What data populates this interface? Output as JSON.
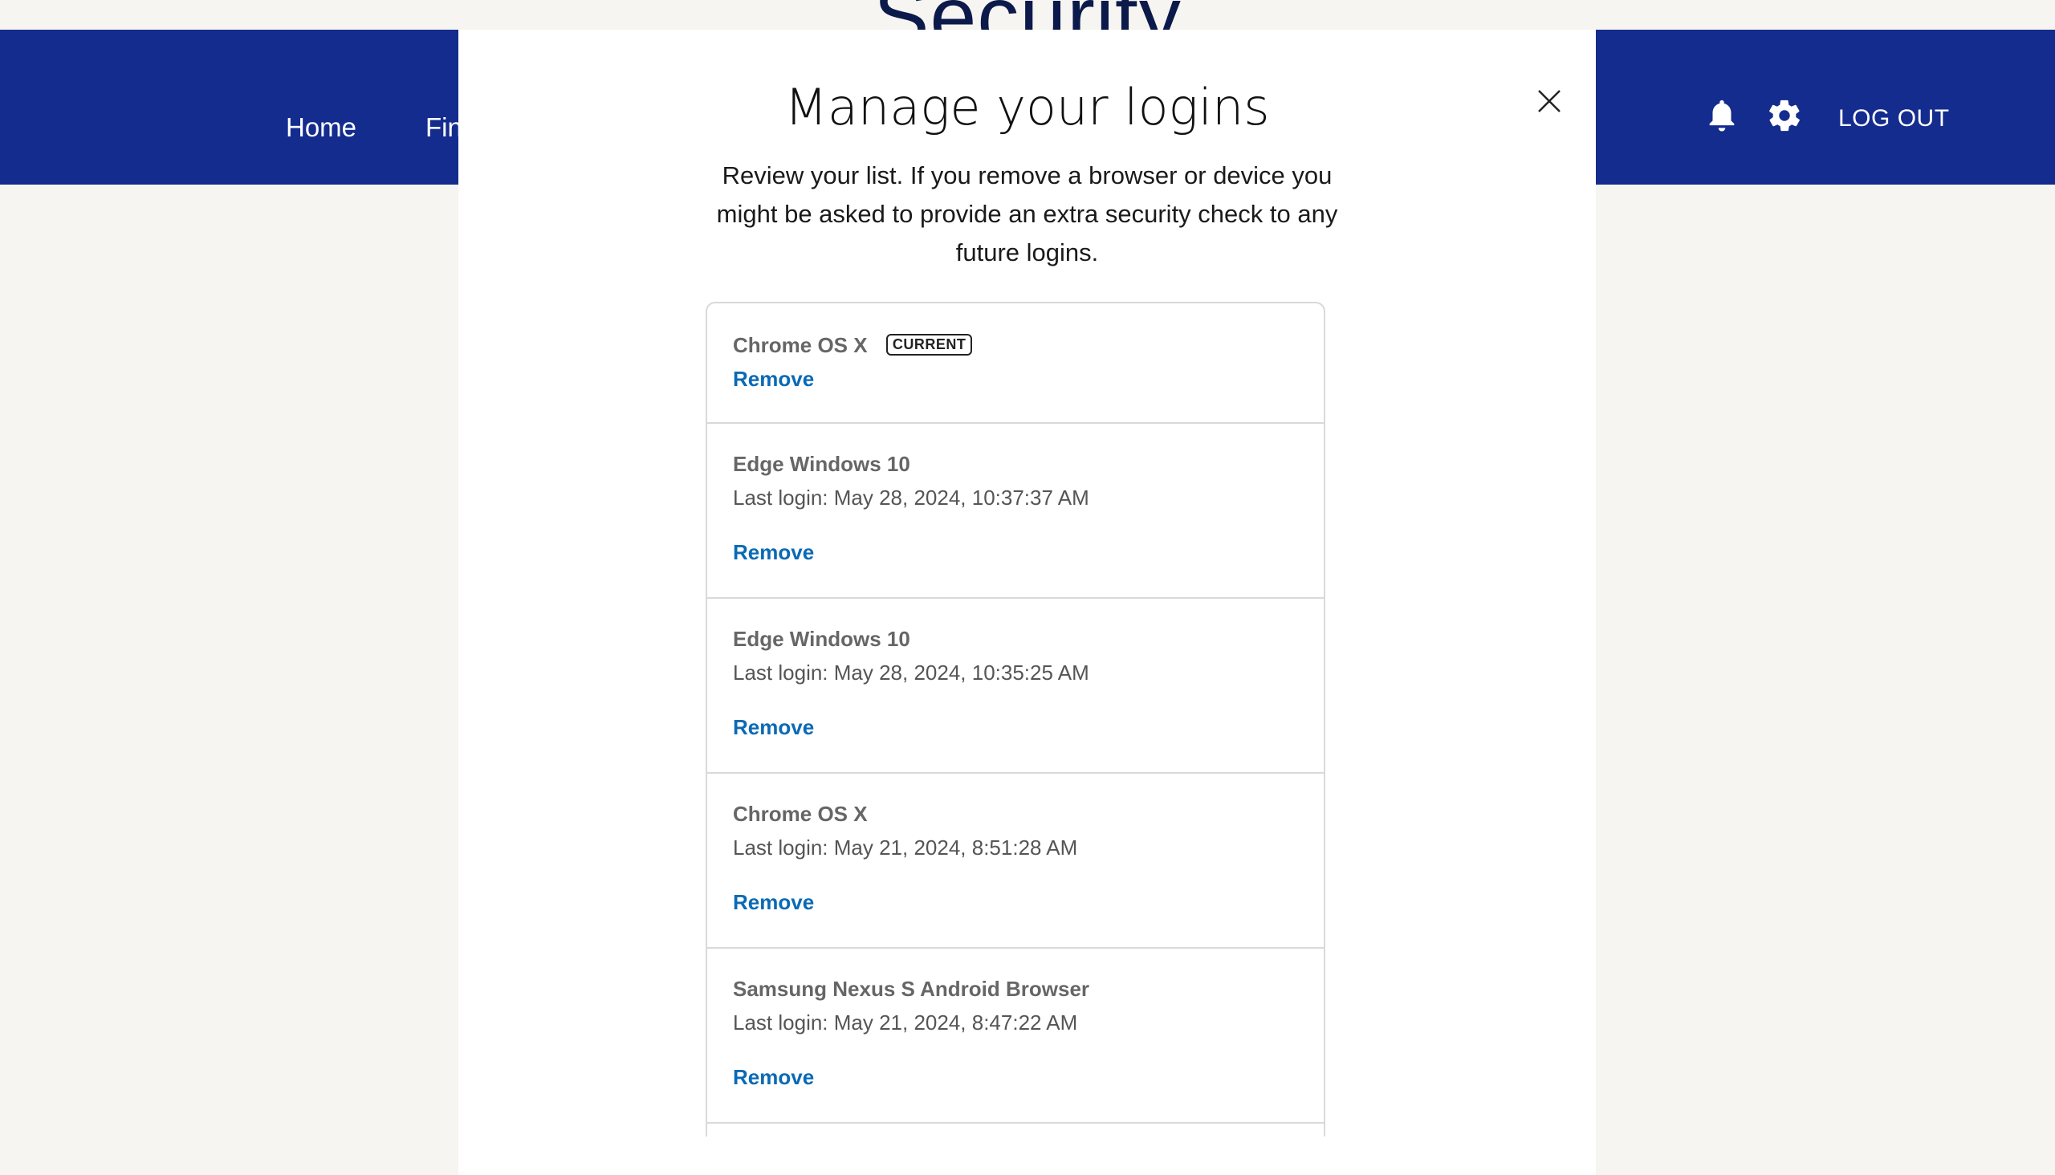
{
  "page": {
    "title": "Security"
  },
  "header": {
    "nav": [
      "Home",
      "Fin"
    ],
    "icons": [
      "bell-icon",
      "gear-icon"
    ],
    "logout_label": "LOG OUT",
    "bg_color": "#142c8e"
  },
  "modal": {
    "title": "Manage your logins",
    "description": "Review your list. If you remove a browser or device you might be asked to provide an extra security check to any future logins.",
    "close_icon": "close-icon"
  },
  "logins": [
    {
      "device": "Chrome OS X",
      "badge": "CURRENT",
      "remove": "Remove"
    },
    {
      "device": "Edge Windows 10",
      "last_login": "Last login: May 28, 2024, 10:37:37 AM",
      "remove": "Remove"
    },
    {
      "device": "Edge Windows 10",
      "last_login": "Last login: May 28, 2024, 10:35:25 AM",
      "remove": "Remove"
    },
    {
      "device": "Chrome OS X",
      "last_login": "Last login: May 21, 2024, 8:51:28 AM",
      "remove": "Remove"
    },
    {
      "device": "Samsung Nexus S Android Browser",
      "last_login": "Last login: May 21, 2024, 8:47:22 AM",
      "remove": "Remove"
    }
  ],
  "colors": {
    "link": "#0a6ab5",
    "page_bg": "#f7f5f1"
  }
}
